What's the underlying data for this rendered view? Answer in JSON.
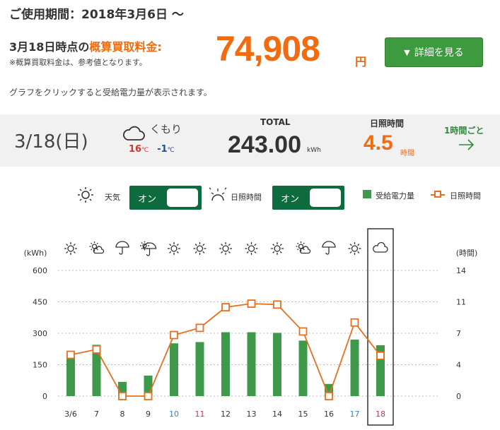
{
  "header": {
    "period": "ご使用期間：2018年3月6日 〜",
    "price_label_prefix": "3月18日時点の",
    "price_label_highlight": "概算買取料金:",
    "price_note": "※概算買取料金は、参考値となります。",
    "price_value": "74,908",
    "price_unit": "円",
    "detail_button": "詳細を見る",
    "hint": "グラフをクリックすると受給電力量が表示されます。"
  },
  "summary": {
    "date": "3/18(日)",
    "weather": "くもり",
    "temp_high": "16",
    "temp_low": "-1",
    "temp_unit": "℃",
    "total_label": "TOTAL",
    "total_value": "243.00",
    "total_unit": "kWh",
    "sunshine_label": "日照時間",
    "sunshine_value": "4.5",
    "sunshine_unit": "時間",
    "hourly_link": "1時間ごと"
  },
  "controls": {
    "weather_label": "天気",
    "weather_toggle": "オン",
    "sunshine_label": "日照時間",
    "sunshine_toggle": "オン",
    "legend_power": "受給電力量",
    "legend_sunshine": "日照時間"
  },
  "colors": {
    "accent": "#f26b0f",
    "bar": "#3e9a4a",
    "line": "#e86f1e",
    "toggle": "#0d6b3e",
    "button": "#3e9a3e",
    "weekday": "#333333",
    "saturday": "#3a7fc2",
    "sunday": "#c0335e"
  },
  "chart_data": {
    "type": "bar",
    "ylabel_left": "(kWh)",
    "ylabel_right": "(時間)",
    "ylim_left": [
      0,
      600
    ],
    "ylim_right": [
      0,
      14
    ],
    "yticks_left": [
      "600",
      "450",
      "300",
      "150",
      "0"
    ],
    "yticks_right": [
      "14",
      "11",
      "7",
      "4",
      "0"
    ],
    "categories": [
      "3/6",
      "7",
      "8",
      "9",
      "10",
      "11",
      "12",
      "13",
      "14",
      "15",
      "16",
      "17",
      "18"
    ],
    "category_kind": [
      "weekday",
      "weekday",
      "weekday",
      "weekday",
      "saturday",
      "sunday",
      "weekday",
      "weekday",
      "weekday",
      "weekday",
      "weekday",
      "saturday",
      "sunday"
    ],
    "weather_icons": [
      "sun-icon",
      "sun-cloud-icon",
      "umbrella-icon",
      "umbrella-sun-icon",
      "sun-icon",
      "sun-icon",
      "sun-icon",
      "sun-icon",
      "sun-icon",
      "sun-cloud-icon",
      "umbrella-icon",
      "sun-icon",
      "cloud-icon"
    ],
    "series": [
      {
        "name": "受給電力量",
        "type": "bar",
        "axis": "left",
        "values": [
          180,
          245,
          68,
          98,
          252,
          258,
          305,
          305,
          302,
          265,
          58,
          270,
          243
        ]
      },
      {
        "name": "日照時間",
        "type": "line",
        "axis": "right",
        "values": [
          4.6,
          5.2,
          0.0,
          0.0,
          6.8,
          7.6,
          9.9,
          10.3,
          10.2,
          7.2,
          0.0,
          8.2,
          4.5
        ]
      }
    ],
    "selected_index": 12,
    "grid": true,
    "legend": "top-right"
  }
}
